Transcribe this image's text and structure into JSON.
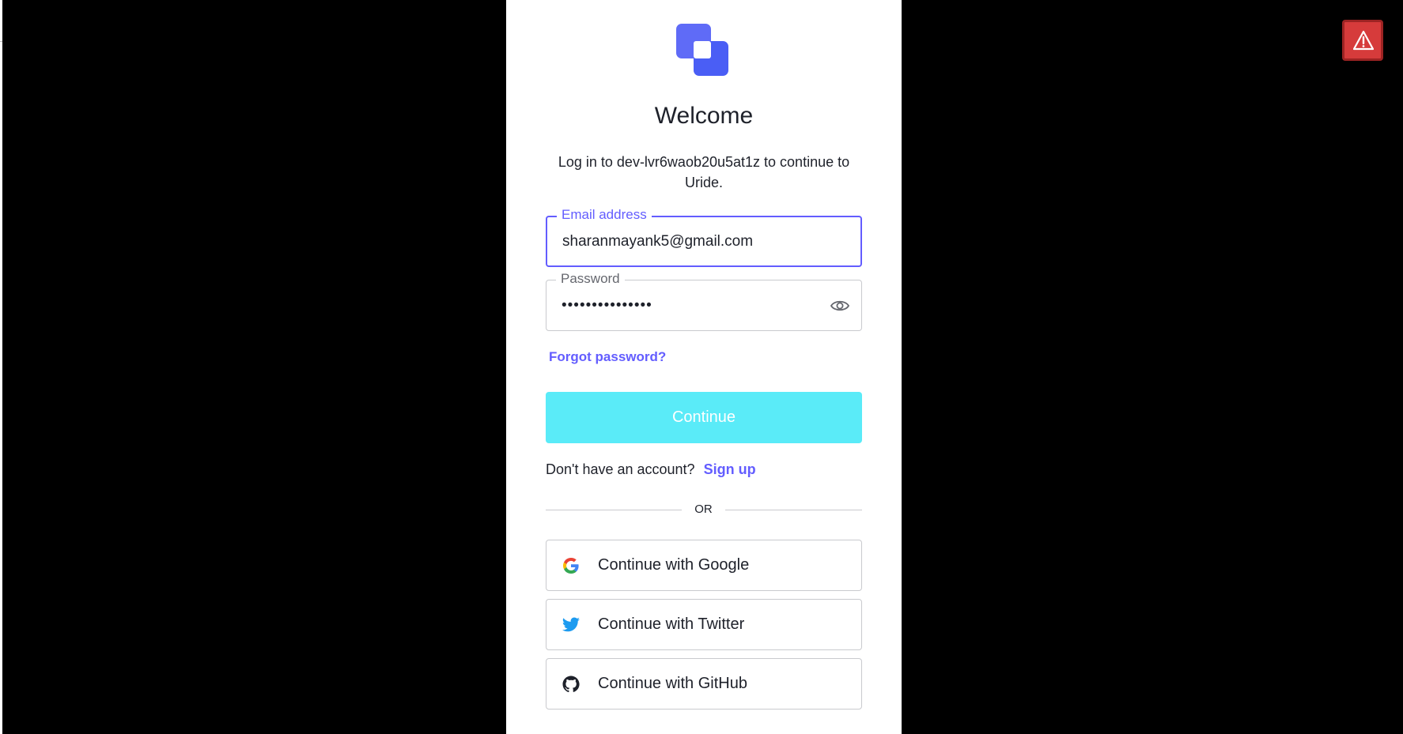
{
  "card": {
    "title": "Welcome",
    "subtitle": "Log in to dev-lvr6waob20u5at1z to continue to Uride."
  },
  "form": {
    "email": {
      "label": "Email address",
      "value": "sharanmayank5@gmail.com"
    },
    "password": {
      "label": "Password",
      "masked_value": "•••••••••••••••"
    },
    "forgot_link": "Forgot password?",
    "continue_label": "Continue",
    "signup_prompt": "Don't have an account?",
    "signup_link": "Sign up",
    "divider_text": "OR"
  },
  "social": [
    {
      "label": "Continue with Google",
      "icon": "google-icon"
    },
    {
      "label": "Continue with Twitter",
      "icon": "twitter-icon"
    },
    {
      "label": "Continue with GitHub",
      "icon": "github-icon"
    }
  ],
  "colors": {
    "accent": "#635dff",
    "continue_button": "#5aebf8",
    "backdrop": "#000000",
    "alert": "#d63b3b"
  },
  "alert": {
    "icon": "warning-icon"
  }
}
